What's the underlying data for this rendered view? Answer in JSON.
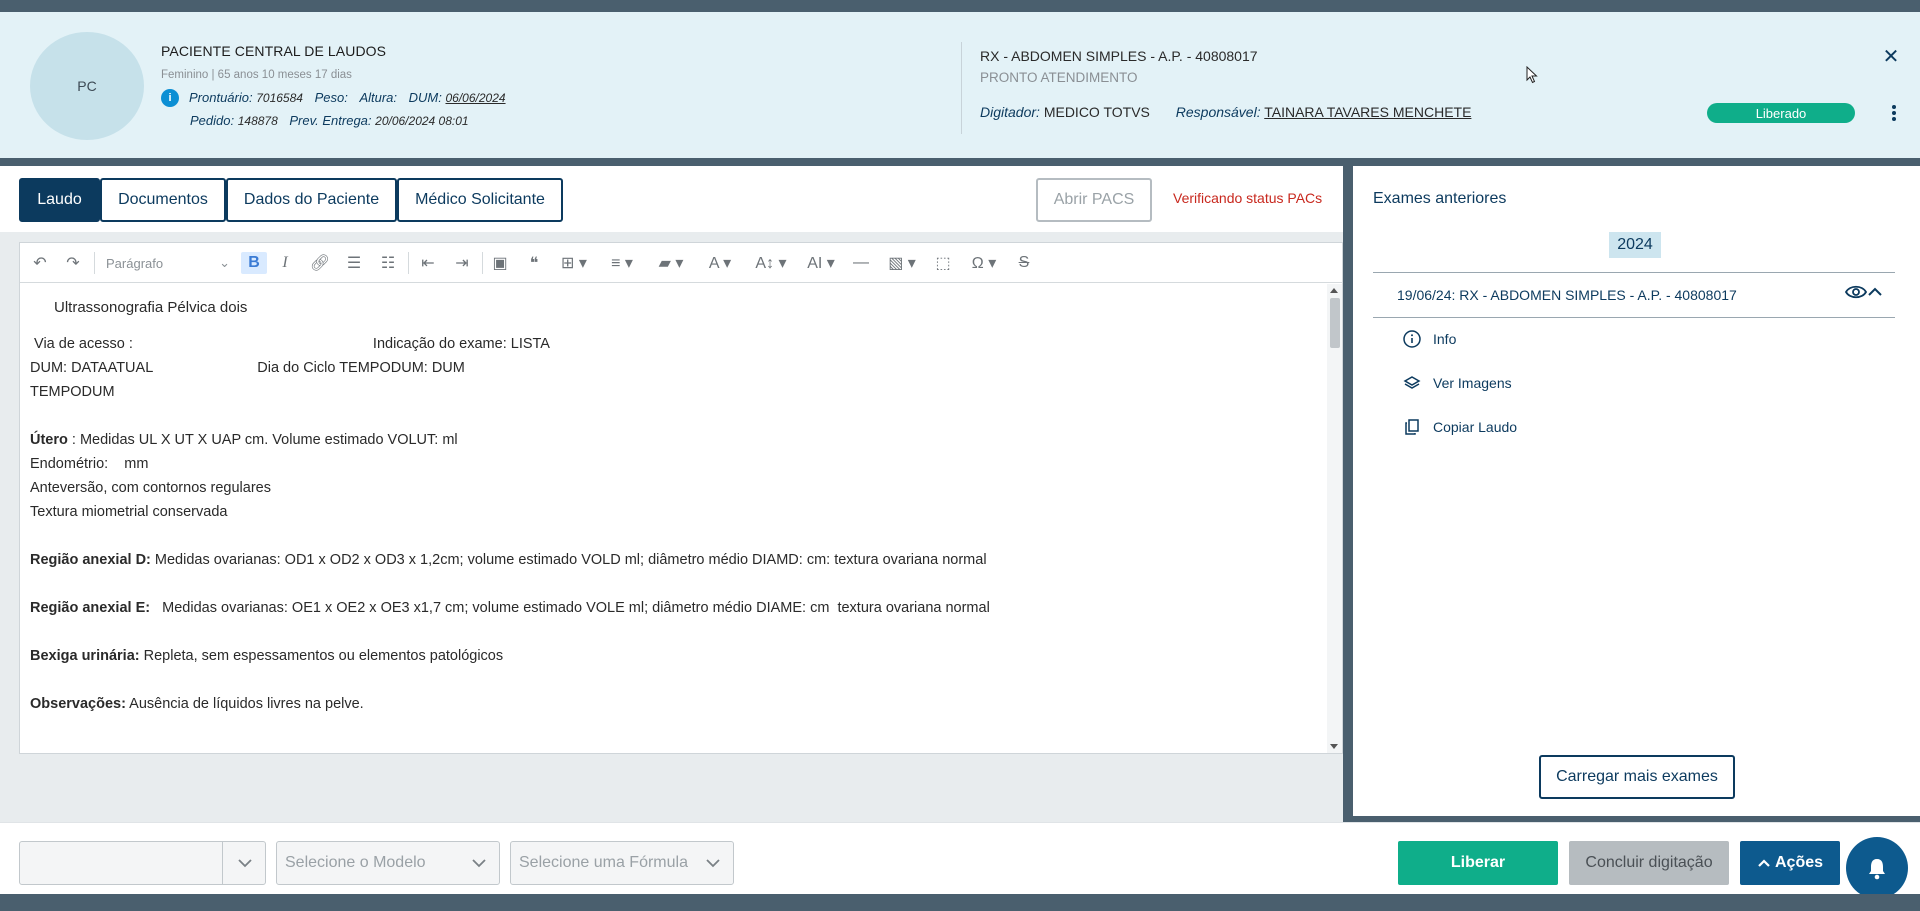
{
  "patient": {
    "initials": "PC",
    "name": "PACIENTE CENTRAL DE LAUDOS",
    "subtitle": "Feminino | 65 anos 10 meses 17 dias",
    "info_badge": "i",
    "prontuario_label": "Prontuário:",
    "prontuario_value": "7016584",
    "peso_label": "Peso:",
    "altura_label": "Altura:",
    "dum_label": "DUM:",
    "dum_value": "06/06/2024",
    "pedido_label": "Pedido:",
    "pedido_value": "148878",
    "prev_entrega_label": "Prev. Entrega:",
    "prev_entrega_value": "20/06/2024 08:01"
  },
  "exam": {
    "title": "RX - ABDOMEN SIMPLES - A.P. - 40808017",
    "subtitle": "PRONTO ATENDIMENTO",
    "digitador_label": "Digitador:",
    "digitador_value": "MEDICO TOTVS",
    "responsavel_label": "Responsável:",
    "responsavel_value": "TAINARA TAVARES MENCHETE",
    "status": "Liberado",
    "status_color": "#0fae8a"
  },
  "tabs": [
    {
      "label": "Laudo"
    },
    {
      "label": "Documentos"
    },
    {
      "label": "Dados do Paciente"
    },
    {
      "label": "Médico Solicitante"
    }
  ],
  "pacs": {
    "button": "Abrir PACS",
    "status": "Verificando status PACs"
  },
  "toolbar": {
    "paragraph": "Parágrafo",
    "icons": [
      "undo-icon",
      "redo-icon",
      "bold-icon",
      "italic-icon",
      "link-icon",
      "bulleted-list-icon",
      "numbered-list-icon",
      "outdent-icon",
      "indent-icon",
      "image-upload-icon",
      "blockquote-icon",
      "table-icon",
      "align-icon",
      "highlight-icon",
      "font-color-icon",
      "font-size-icon",
      "text-case-icon",
      "horizontal-line-icon",
      "insert-image-icon",
      "select-all-icon",
      "special-characters-icon",
      "strikethrough-icon"
    ]
  },
  "document": {
    "title": "Ultrassonografia Pélvica dois",
    "via_label": " Via de acesso :",
    "indicacao": "Indicação do exame: LISTA",
    "dum_line": "DUM: DATAATUAL",
    "ciclo": "Dia do Ciclo TEMPODUM: DUM",
    "tempodum": "TEMPODUM",
    "utero_label": "Útero",
    "utero_text": " : Medidas UL X UT X UAP cm. Volume estimado VOLUT: ml",
    "endometrio": "Endométrio:    mm",
    "anteversao": "Anteversão, com contornos regulares",
    "textura": "Textura miometrial conservada",
    "anexial_d_label": "Região anexial D:",
    "anexial_d_text": " Medidas ovarianas: OD1 x OD2 x OD3 x 1,2cm; volume estimado VOLD ml; diâmetro médio DIAMD: cm: textura ovariana normal",
    "anexial_e_label": "Região anexial E:",
    "anexial_e_text": "   Medidas ovarianas: OE1 x OE2 x OE3 x1,7 cm; volume estimado VOLE ml; diâmetro médio DIAME: cm  textura ovariana normal",
    "bexiga_label": "Bexiga urinária:",
    "bexiga_text": " Repleta, sem espessamentos ou elementos patológicos",
    "obs_label": "Observações:",
    "obs_text": " Ausência de líquidos livres na pelve."
  },
  "previous": {
    "title": "Exames anteriores",
    "year": "2024",
    "exam": "19/06/24: RX - ABDOMEN SIMPLES - A.P. - 40808017",
    "items": [
      {
        "label": "Info",
        "icon": "info-icon"
      },
      {
        "label": "Ver Imagens",
        "icon": "layers-icon"
      },
      {
        "label": "Copiar Laudo",
        "icon": "copy-icon"
      }
    ],
    "load_more": "Carregar mais exames"
  },
  "footer": {
    "select1_value": "",
    "model_placeholder": "Selecione o Modelo",
    "formula_placeholder": "Selecione uma Fórmula",
    "release": "Liberar",
    "conclude": "Concluir digitação",
    "actions": "Ações"
  }
}
